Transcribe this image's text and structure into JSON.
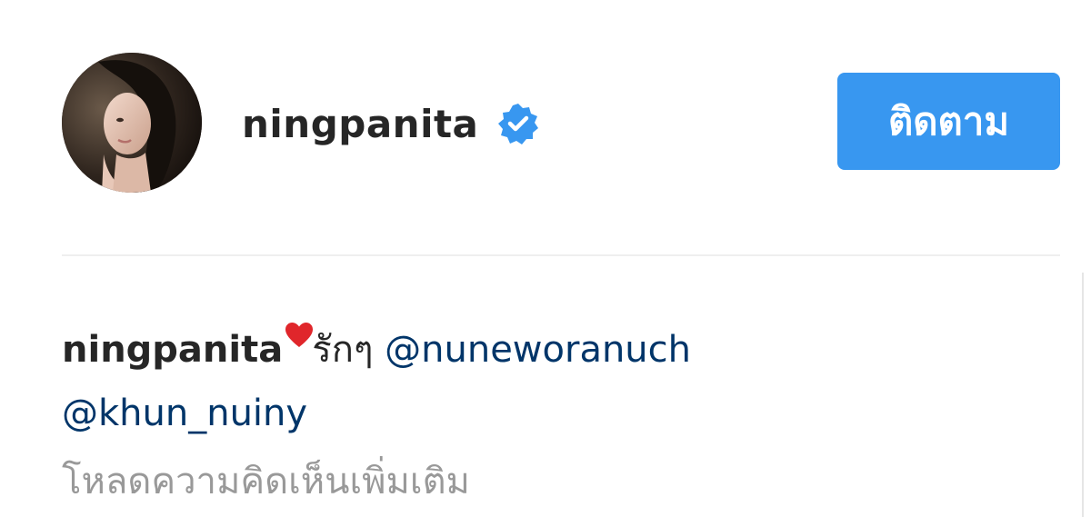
{
  "header": {
    "username": "ningpanita",
    "verified_icon": "verified-badge-icon",
    "follow_label": "ติดตาม",
    "accent_color": "#3897f0"
  },
  "comment": {
    "username": "ningpanita",
    "emoji": "heart-icon",
    "text": "รักๆ ",
    "mentions": [
      "@nuneworanuch",
      "@khun_nuiny"
    ],
    "mention_color": "#003569"
  },
  "load_more_label": "โหลดความคิดเห็นเพิ่มเติม"
}
